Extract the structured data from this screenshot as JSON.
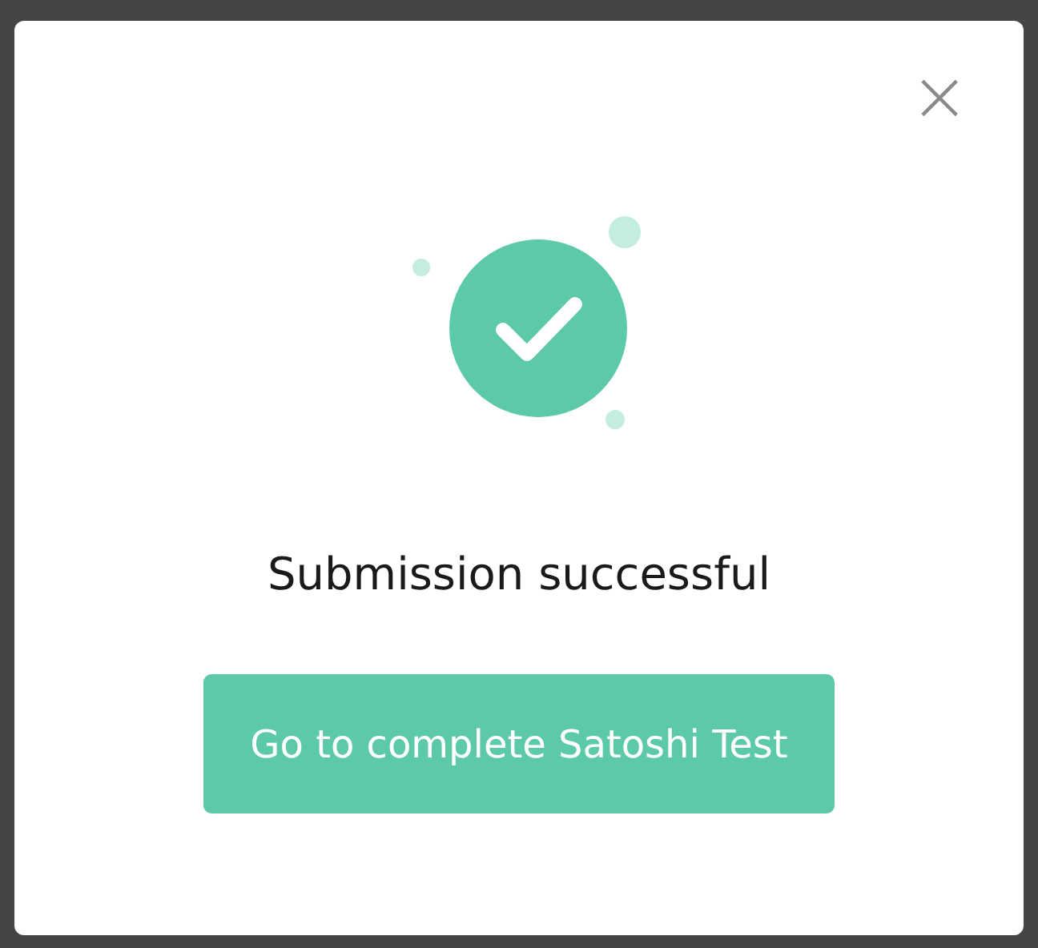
{
  "dialog": {
    "close": "×",
    "message": "Submission successful",
    "button": "Go to complete Satoshi Test"
  }
}
